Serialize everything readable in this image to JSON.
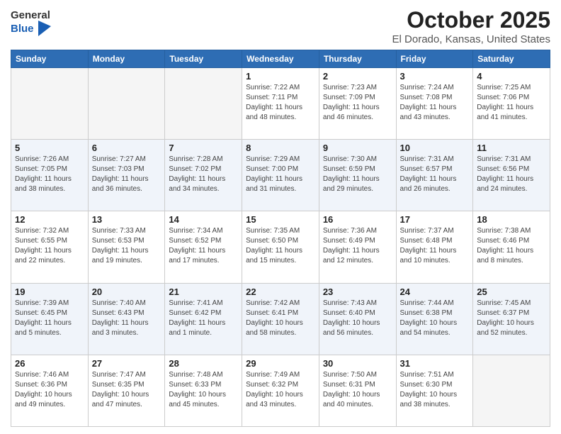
{
  "header": {
    "logo_general": "General",
    "logo_blue": "Blue",
    "title": "October 2025",
    "subtitle": "El Dorado, Kansas, United States"
  },
  "weekdays": [
    "Sunday",
    "Monday",
    "Tuesday",
    "Wednesday",
    "Thursday",
    "Friday",
    "Saturday"
  ],
  "weeks": [
    [
      {
        "num": "",
        "info": ""
      },
      {
        "num": "",
        "info": ""
      },
      {
        "num": "",
        "info": ""
      },
      {
        "num": "1",
        "info": "Sunrise: 7:22 AM\nSunset: 7:11 PM\nDaylight: 11 hours\nand 48 minutes."
      },
      {
        "num": "2",
        "info": "Sunrise: 7:23 AM\nSunset: 7:09 PM\nDaylight: 11 hours\nand 46 minutes."
      },
      {
        "num": "3",
        "info": "Sunrise: 7:24 AM\nSunset: 7:08 PM\nDaylight: 11 hours\nand 43 minutes."
      },
      {
        "num": "4",
        "info": "Sunrise: 7:25 AM\nSunset: 7:06 PM\nDaylight: 11 hours\nand 41 minutes."
      }
    ],
    [
      {
        "num": "5",
        "info": "Sunrise: 7:26 AM\nSunset: 7:05 PM\nDaylight: 11 hours\nand 38 minutes."
      },
      {
        "num": "6",
        "info": "Sunrise: 7:27 AM\nSunset: 7:03 PM\nDaylight: 11 hours\nand 36 minutes."
      },
      {
        "num": "7",
        "info": "Sunrise: 7:28 AM\nSunset: 7:02 PM\nDaylight: 11 hours\nand 34 minutes."
      },
      {
        "num": "8",
        "info": "Sunrise: 7:29 AM\nSunset: 7:00 PM\nDaylight: 11 hours\nand 31 minutes."
      },
      {
        "num": "9",
        "info": "Sunrise: 7:30 AM\nSunset: 6:59 PM\nDaylight: 11 hours\nand 29 minutes."
      },
      {
        "num": "10",
        "info": "Sunrise: 7:31 AM\nSunset: 6:57 PM\nDaylight: 11 hours\nand 26 minutes."
      },
      {
        "num": "11",
        "info": "Sunrise: 7:31 AM\nSunset: 6:56 PM\nDaylight: 11 hours\nand 24 minutes."
      }
    ],
    [
      {
        "num": "12",
        "info": "Sunrise: 7:32 AM\nSunset: 6:55 PM\nDaylight: 11 hours\nand 22 minutes."
      },
      {
        "num": "13",
        "info": "Sunrise: 7:33 AM\nSunset: 6:53 PM\nDaylight: 11 hours\nand 19 minutes."
      },
      {
        "num": "14",
        "info": "Sunrise: 7:34 AM\nSunset: 6:52 PM\nDaylight: 11 hours\nand 17 minutes."
      },
      {
        "num": "15",
        "info": "Sunrise: 7:35 AM\nSunset: 6:50 PM\nDaylight: 11 hours\nand 15 minutes."
      },
      {
        "num": "16",
        "info": "Sunrise: 7:36 AM\nSunset: 6:49 PM\nDaylight: 11 hours\nand 12 minutes."
      },
      {
        "num": "17",
        "info": "Sunrise: 7:37 AM\nSunset: 6:48 PM\nDaylight: 11 hours\nand 10 minutes."
      },
      {
        "num": "18",
        "info": "Sunrise: 7:38 AM\nSunset: 6:46 PM\nDaylight: 11 hours\nand 8 minutes."
      }
    ],
    [
      {
        "num": "19",
        "info": "Sunrise: 7:39 AM\nSunset: 6:45 PM\nDaylight: 11 hours\nand 5 minutes."
      },
      {
        "num": "20",
        "info": "Sunrise: 7:40 AM\nSunset: 6:43 PM\nDaylight: 11 hours\nand 3 minutes."
      },
      {
        "num": "21",
        "info": "Sunrise: 7:41 AM\nSunset: 6:42 PM\nDaylight: 11 hours\nand 1 minute."
      },
      {
        "num": "22",
        "info": "Sunrise: 7:42 AM\nSunset: 6:41 PM\nDaylight: 10 hours\nand 58 minutes."
      },
      {
        "num": "23",
        "info": "Sunrise: 7:43 AM\nSunset: 6:40 PM\nDaylight: 10 hours\nand 56 minutes."
      },
      {
        "num": "24",
        "info": "Sunrise: 7:44 AM\nSunset: 6:38 PM\nDaylight: 10 hours\nand 54 minutes."
      },
      {
        "num": "25",
        "info": "Sunrise: 7:45 AM\nSunset: 6:37 PM\nDaylight: 10 hours\nand 52 minutes."
      }
    ],
    [
      {
        "num": "26",
        "info": "Sunrise: 7:46 AM\nSunset: 6:36 PM\nDaylight: 10 hours\nand 49 minutes."
      },
      {
        "num": "27",
        "info": "Sunrise: 7:47 AM\nSunset: 6:35 PM\nDaylight: 10 hours\nand 47 minutes."
      },
      {
        "num": "28",
        "info": "Sunrise: 7:48 AM\nSunset: 6:33 PM\nDaylight: 10 hours\nand 45 minutes."
      },
      {
        "num": "29",
        "info": "Sunrise: 7:49 AM\nSunset: 6:32 PM\nDaylight: 10 hours\nand 43 minutes."
      },
      {
        "num": "30",
        "info": "Sunrise: 7:50 AM\nSunset: 6:31 PM\nDaylight: 10 hours\nand 40 minutes."
      },
      {
        "num": "31",
        "info": "Sunrise: 7:51 AM\nSunset: 6:30 PM\nDaylight: 10 hours\nand 38 minutes."
      },
      {
        "num": "",
        "info": ""
      }
    ]
  ]
}
